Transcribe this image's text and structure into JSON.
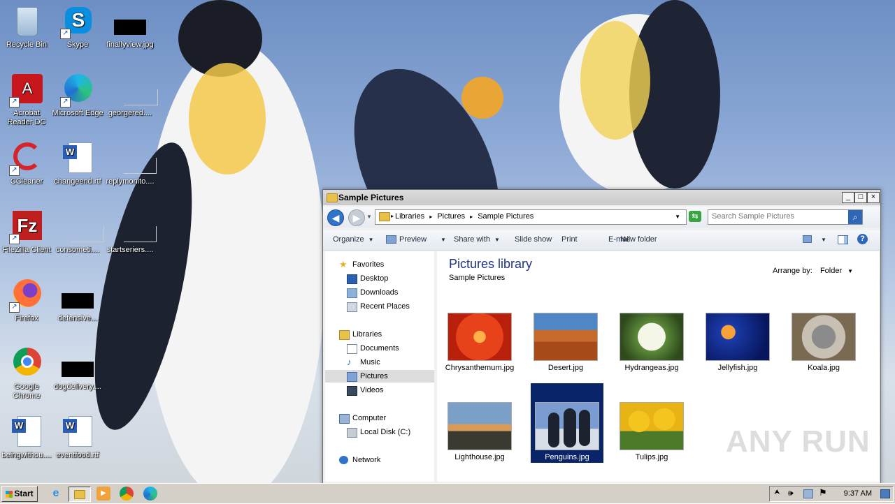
{
  "desktop": {
    "icons": [
      {
        "label": "Recycle Bin"
      },
      {
        "label": "Skype"
      },
      {
        "label": "finallyview.jpg"
      },
      {
        "label": "Acrobat Reader DC"
      },
      {
        "label": "Microsoft Edge"
      },
      {
        "label": "georgered...."
      },
      {
        "label": "CCleaner"
      },
      {
        "label": "changeend.rtf"
      },
      {
        "label": "replymonito...."
      },
      {
        "label": "FileZilla Client"
      },
      {
        "label": "consometi...."
      },
      {
        "label": "startseriers...."
      },
      {
        "label": "Firefox"
      },
      {
        "label": "defensive..."
      },
      {
        "label": "Google Chrome"
      },
      {
        "label": "dogdelivery...."
      },
      {
        "label": "beingwithou...."
      },
      {
        "label": "eventfood.rtf"
      }
    ]
  },
  "window": {
    "title": "Sample Pictures",
    "controls": {
      "minimize": "_",
      "maximize": "□",
      "close": "×"
    },
    "breadcrumb": [
      "Libraries",
      "Pictures",
      "Sample Pictures"
    ],
    "search_placeholder": "Search Sample Pictures",
    "toolbar": {
      "organize": "Organize",
      "preview": "Preview",
      "share_with": "Share with",
      "slide_show": "Slide show",
      "print": "Print",
      "email": "E-mail",
      "new_folder": "New folder"
    },
    "nav": {
      "favorites": "Favorites",
      "desktop": "Desktop",
      "downloads": "Downloads",
      "recent_places": "Recent Places",
      "libraries": "Libraries",
      "documents": "Documents",
      "music": "Music",
      "pictures": "Pictures",
      "videos": "Videos",
      "computer": "Computer",
      "local_disk": "Local Disk (C:)",
      "network": "Network"
    },
    "content": {
      "title": "Pictures library",
      "subtitle": "Sample Pictures",
      "arrange_by_label": "Arrange by:",
      "arrange_by_value": "Folder",
      "files": [
        {
          "name": "Chrysanthemum.jpg"
        },
        {
          "name": "Desert.jpg"
        },
        {
          "name": "Hydrangeas.jpg"
        },
        {
          "name": "Jellyfish.jpg"
        },
        {
          "name": "Koala.jpg"
        },
        {
          "name": "Lighthouse.jpg"
        },
        {
          "name": "Penguins.jpg"
        },
        {
          "name": "Tulips.jpg"
        }
      ]
    }
  },
  "taskbar": {
    "start_label": "Start",
    "clock": "9:37 AM"
  },
  "watermark": "ANY RUN"
}
